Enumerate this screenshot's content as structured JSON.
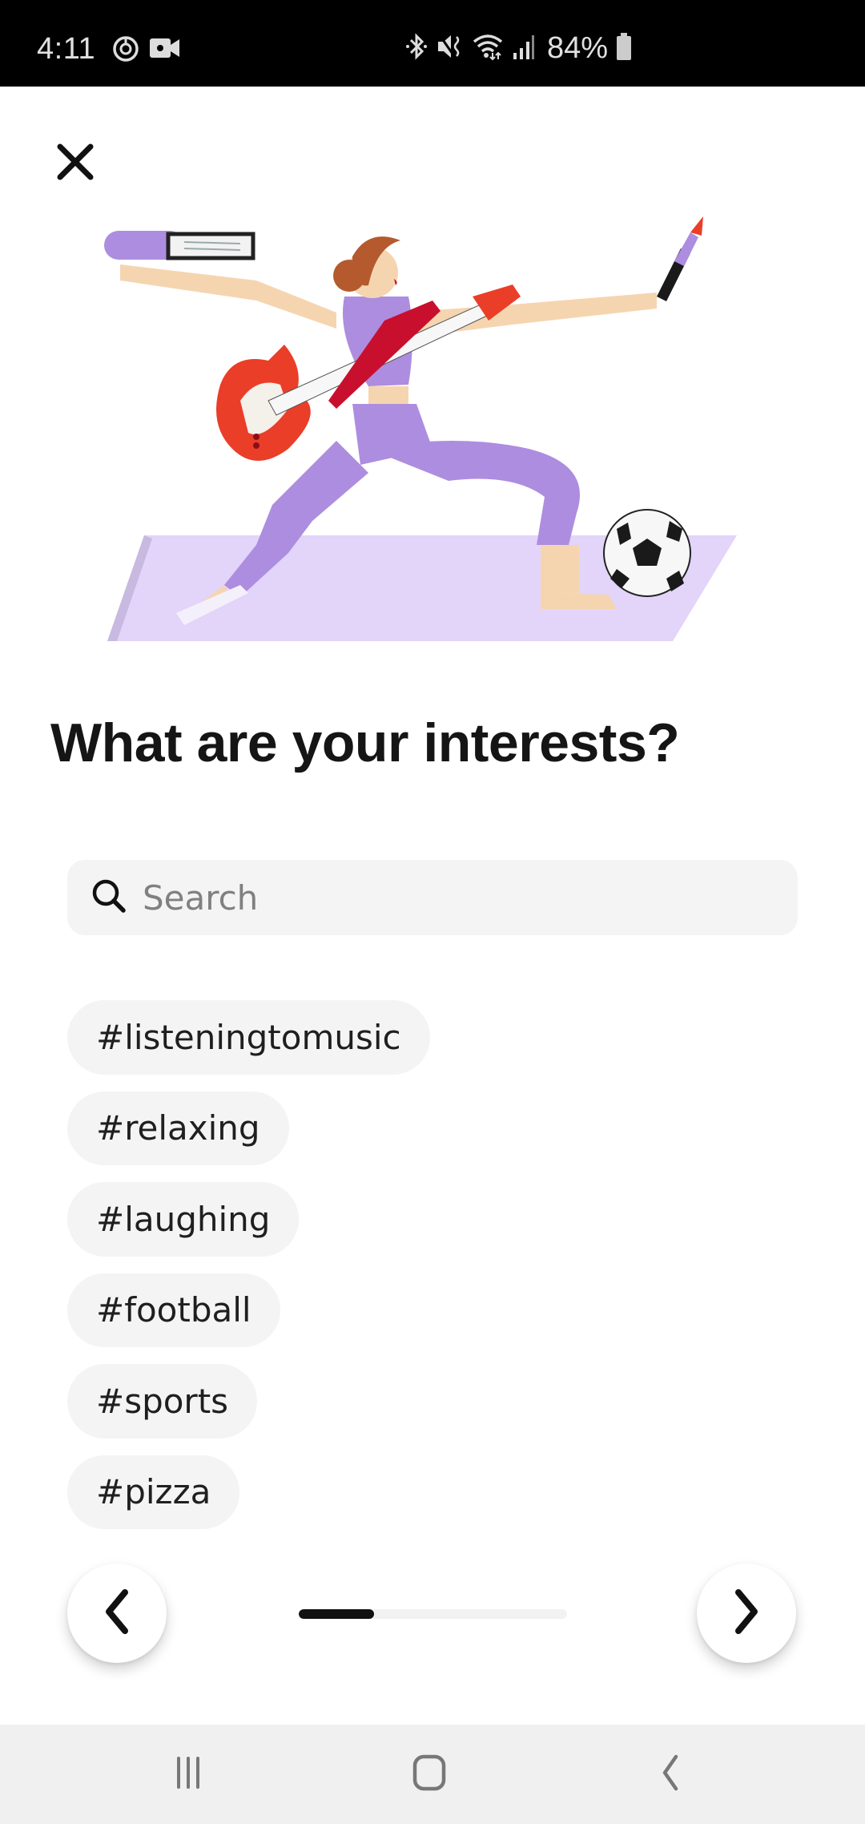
{
  "status_bar": {
    "time": "4:11",
    "left_icons": [
      "data-saver-icon",
      "video-call-icon"
    ],
    "right_icons": [
      "bluetooth-icon",
      "mute-vibrate-icon",
      "wifi-icon",
      "signal-icon"
    ],
    "battery_percent": "84%",
    "battery_level": 84
  },
  "header": {
    "close_icon": "close-icon"
  },
  "illustration": {
    "description": "Woman in lunge pose on yoga mat holding a book, guitar, paintbrush, with a soccer ball",
    "colors": {
      "mat": "#e3d4fa",
      "outfit": "#ad8ddf",
      "guitar": "#ea3e28",
      "skin": "#f5d5b0",
      "hair": "#b45a2e"
    }
  },
  "main": {
    "title": "What are your interests?",
    "search": {
      "placeholder": "Search",
      "value": ""
    },
    "interests": [
      {
        "label": "#listeningtomusic"
      },
      {
        "label": "#relaxing"
      },
      {
        "label": "#laughing"
      },
      {
        "label": "#football"
      },
      {
        "label": "#sports"
      },
      {
        "label": "#pizza"
      }
    ]
  },
  "footer": {
    "prev_icon": "chevron-left-icon",
    "next_icon": "chevron-right-icon",
    "progress_percent": 28
  },
  "system_nav": {
    "recents_icon": "recent-apps-icon",
    "home_icon": "home-icon",
    "back_icon": "back-icon"
  },
  "colors": {
    "chip_bg": "#f3f4f3",
    "text_primary": "#151515",
    "placeholder": "#808080",
    "progress_fill": "#111111",
    "progress_track": "#f2f2f2",
    "nav_bar_bg": "#f0f0f0"
  }
}
